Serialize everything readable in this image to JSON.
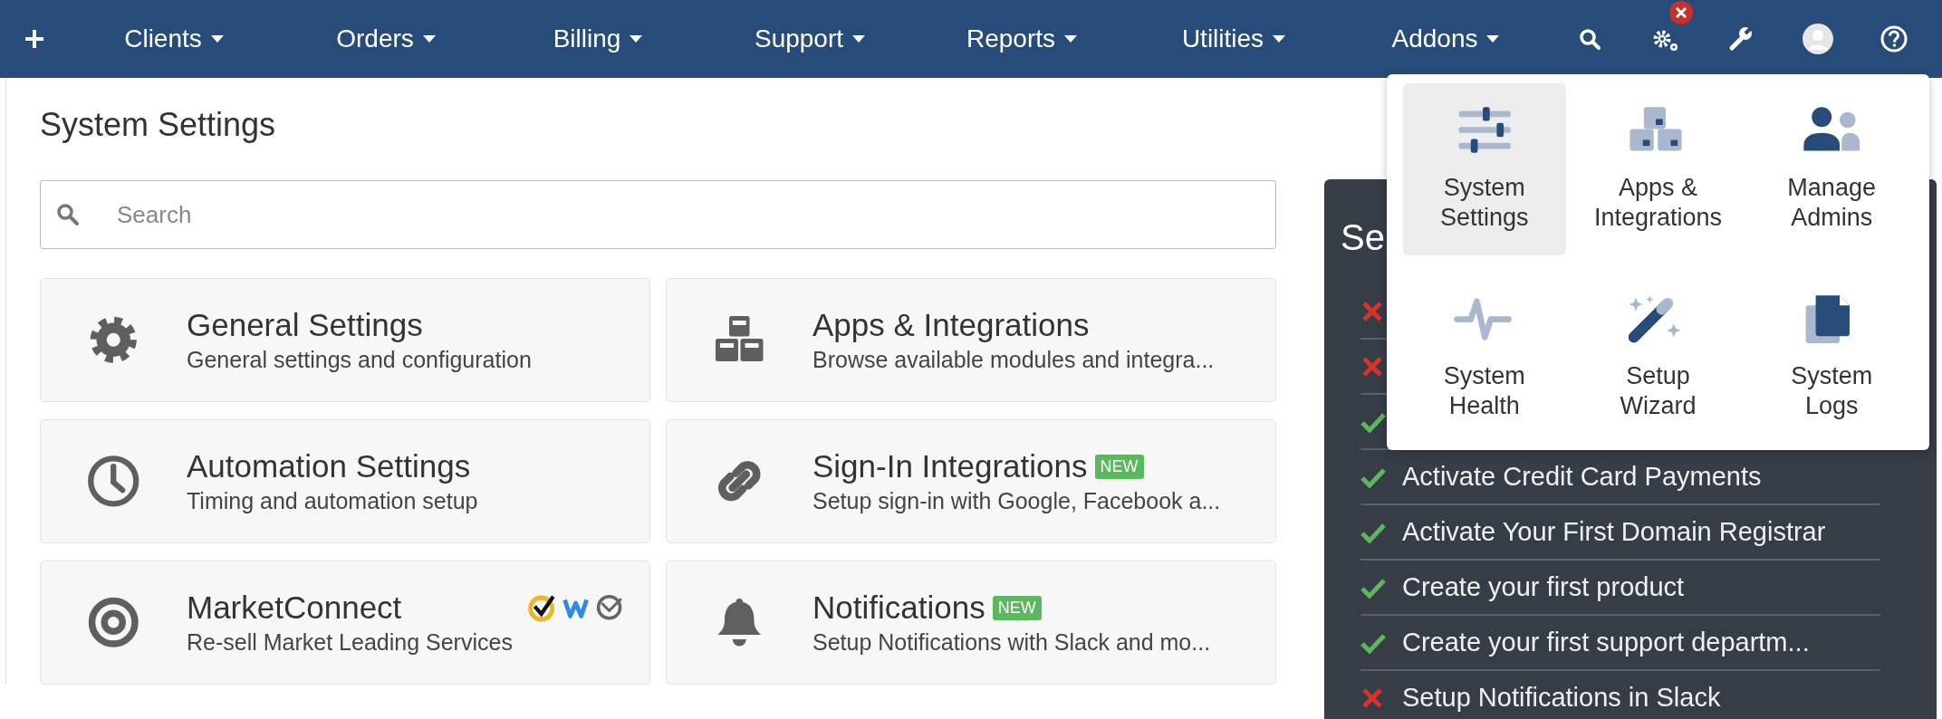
{
  "nav": {
    "items": [
      {
        "label": "Clients"
      },
      {
        "label": "Orders"
      },
      {
        "label": "Billing"
      },
      {
        "label": "Support"
      },
      {
        "label": "Reports"
      },
      {
        "label": "Utilities"
      },
      {
        "label": "Addons"
      }
    ],
    "tools": [
      {
        "kind": "search",
        "alert": false
      },
      {
        "kind": "gears",
        "alert": true
      },
      {
        "kind": "wrench",
        "alert": false
      },
      {
        "kind": "avatar",
        "alert": false
      },
      {
        "kind": "help",
        "alert": false
      }
    ]
  },
  "page": {
    "title": "System Settings",
    "search": {
      "placeholder": "Search"
    },
    "cards": [
      {
        "kind": "gear",
        "title": "General Settings",
        "description": "General settings and configuration"
      },
      {
        "kind": "cubes",
        "title": "Apps & Integrations",
        "description": "Browse available modules and integra..."
      },
      {
        "kind": "clock",
        "title": "Automation Settings",
        "description": "Timing and automation setup"
      },
      {
        "kind": "link",
        "title": "Sign-In Integrations",
        "badge": "NEW",
        "description": "Setup sign-in with Google, Facebook a..."
      },
      {
        "kind": "target",
        "title": "MarketConnect",
        "partners": [
          {
            "kind": "check"
          },
          {
            "kind": "wave"
          },
          {
            "kind": "mail"
          }
        ],
        "description": "Re-sell Market Leading Services"
      },
      {
        "kind": "bell",
        "title": "Notifications",
        "badge": "NEW",
        "description": "Setup Notifications with Slack and mo..."
      }
    ]
  },
  "setup_panel": {
    "title": "Se",
    "tasks": [
      {
        "done": false
      },
      {
        "done": false
      },
      {
        "done": true
      },
      {
        "done": true,
        "label": "Activate Credit Card Payments"
      },
      {
        "done": true,
        "label": "Activate Your First Domain Registrar"
      },
      {
        "done": true,
        "label": "Create your first product"
      },
      {
        "done": true,
        "label": "Create your first support departm..."
      },
      {
        "done": false,
        "label": "Setup Notifications in Slack"
      }
    ]
  },
  "config_menu": {
    "items": [
      {
        "kind": "sliders",
        "label": "System Settings",
        "selected": true
      },
      {
        "kind": "cubes",
        "label": "Apps & Integrations",
        "selected": false
      },
      {
        "kind": "users",
        "label": "Manage Admins",
        "selected": false
      },
      {
        "kind": "pulse",
        "label": "System Health",
        "selected": false
      },
      {
        "kind": "wand",
        "label": "Setup Wizard",
        "selected": false
      },
      {
        "kind": "files",
        "label": "System Logs",
        "selected": false
      }
    ]
  }
}
